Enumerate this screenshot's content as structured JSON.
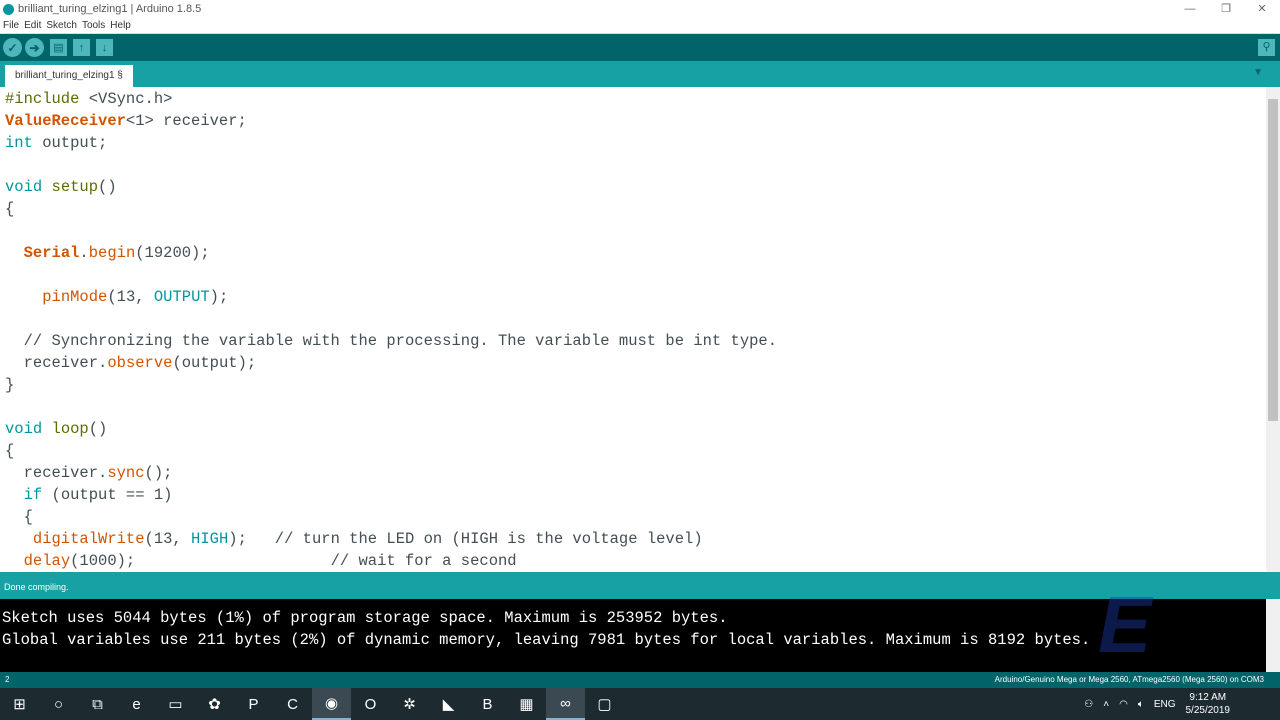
{
  "window": {
    "title": "brilliant_turing_elzing1 | Arduino 1.8.5",
    "minimize": "—",
    "maximize": "❐",
    "close": "✕"
  },
  "menu": [
    "File",
    "Edit",
    "Sketch",
    "Tools",
    "Help"
  ],
  "toolbar": {
    "verify": "✓",
    "upload": "➔",
    "new": "▤",
    "open": "↑",
    "save": "↓",
    "serial_monitor": "⚲"
  },
  "tab": {
    "label": "brilliant_turing_elzing1 §",
    "menu": "▼"
  },
  "code": [
    [
      [
        "#include",
        "k-pre"
      ],
      [
        " <VSync.h>",
        ""
      ]
    ],
    [
      [
        "ValueReceiver",
        "k-cls"
      ],
      [
        "<1> receiver;",
        ""
      ]
    ],
    [
      [
        "int",
        "k-type"
      ],
      [
        " output;",
        ""
      ]
    ],
    [
      [
        "",
        ""
      ]
    ],
    [
      [
        "void",
        "k-type"
      ],
      [
        " ",
        ""
      ],
      [
        "setup",
        "k-def"
      ],
      [
        "()",
        ""
      ]
    ],
    [
      [
        "{",
        ""
      ]
    ],
    [
      [
        "",
        ""
      ]
    ],
    [
      [
        "  ",
        ""
      ],
      [
        "Serial",
        "k-cls"
      ],
      [
        ".",
        ""
      ],
      [
        "begin",
        "k-fn"
      ],
      [
        "(19200);",
        ""
      ]
    ],
    [
      [
        "",
        ""
      ]
    ],
    [
      [
        "    ",
        ""
      ],
      [
        "pinMode",
        "k-fn"
      ],
      [
        "(13, ",
        ""
      ],
      [
        "OUTPUT",
        "k-const"
      ],
      [
        ");",
        ""
      ]
    ],
    [
      [
        "",
        ""
      ]
    ],
    [
      [
        "  // Synchronizing the variable with the processing. The variable must be int type.",
        "k-cm"
      ]
    ],
    [
      [
        "  receiver.",
        ""
      ],
      [
        "observe",
        "k-fn"
      ],
      [
        "(output);",
        ""
      ]
    ],
    [
      [
        "}",
        ""
      ]
    ],
    [
      [
        "",
        ""
      ]
    ],
    [
      [
        "void",
        "k-type"
      ],
      [
        " ",
        ""
      ],
      [
        "loop",
        "k-def"
      ],
      [
        "()",
        ""
      ]
    ],
    [
      [
        "{",
        ""
      ]
    ],
    [
      [
        "  receiver.",
        ""
      ],
      [
        "sync",
        "k-fn"
      ],
      [
        "();",
        ""
      ]
    ],
    [
      [
        "  ",
        ""
      ],
      [
        "if",
        "k-type"
      ],
      [
        " (output == 1)",
        ""
      ]
    ],
    [
      [
        "  {",
        ""
      ]
    ],
    [
      [
        "   ",
        ""
      ],
      [
        "digitalWrite",
        "k-fn"
      ],
      [
        "(13, ",
        ""
      ],
      [
        "HIGH",
        "k-const"
      ],
      [
        ");   // turn the LED on (HIGH is the voltage level)",
        ""
      ]
    ],
    [
      [
        "  ",
        ""
      ],
      [
        "delay",
        "k-fn"
      ],
      [
        "(1000);                     // wait for a second",
        ""
      ]
    ]
  ],
  "status": {
    "message": "Done compiling."
  },
  "console": [
    "Sketch uses 5044 bytes (1%) of program storage space. Maximum is 253952 bytes.",
    "Global variables use 211 bytes (2%) of dynamic memory, leaving 7981 bytes for local variables. Maximum is 8192 bytes."
  ],
  "bottom": {
    "line": "2",
    "board": "Arduino/Genuino Mega or Mega 2560, ATmega2560 (Mega 2560) on COM3"
  },
  "taskbar": {
    "apps": [
      {
        "name": "start",
        "glyph": "⊞"
      },
      {
        "name": "cortana",
        "glyph": "○"
      },
      {
        "name": "task-view",
        "glyph": "⧉"
      },
      {
        "name": "edge",
        "glyph": "e"
      },
      {
        "name": "file-explorer",
        "glyph": "▭"
      },
      {
        "name": "app",
        "glyph": "✿"
      },
      {
        "name": "powerpoint",
        "glyph": "P"
      },
      {
        "name": "camtasia",
        "glyph": "C"
      },
      {
        "name": "chrome",
        "glyph": "◉",
        "active": true
      },
      {
        "name": "opera",
        "glyph": "O"
      },
      {
        "name": "app2",
        "glyph": "✲"
      },
      {
        "name": "app3",
        "glyph": "◣"
      },
      {
        "name": "app4",
        "glyph": "B"
      },
      {
        "name": "app5",
        "glyph": "▦"
      },
      {
        "name": "arduino",
        "glyph": "∞",
        "active": true
      },
      {
        "name": "app6",
        "glyph": "▢"
      }
    ],
    "tray": {
      "language": "ENG",
      "time": "9:12 AM",
      "date": "5/25/2019"
    }
  },
  "watermark": "E"
}
